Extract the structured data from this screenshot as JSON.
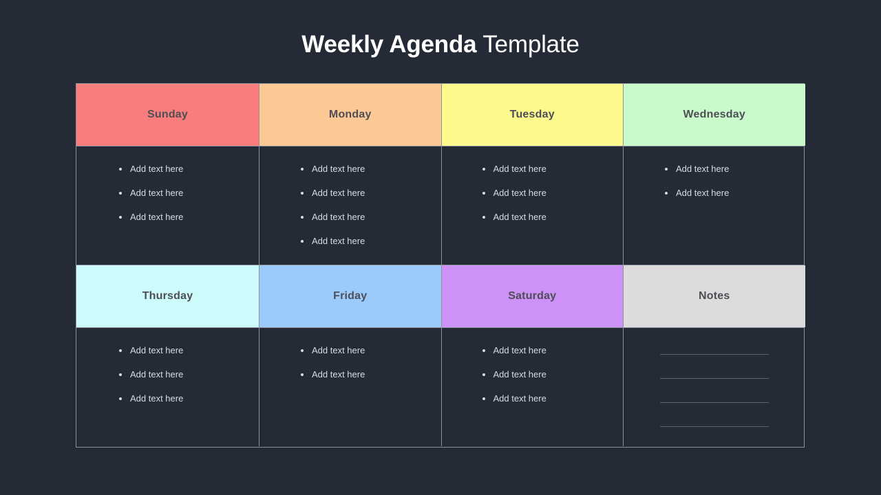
{
  "title": {
    "bold_part": "Weekly Agenda",
    "light_part": " Template"
  },
  "colors": {
    "background": "#242a36",
    "grid_border": "#8d929c",
    "header_text": "#4e4e56",
    "body_text": "#d8dce3",
    "notes_rule": "#5d6573",
    "sunday": "#fa7d7d",
    "monday": "#fcc893",
    "tuesday": "#fcf98d",
    "wednesday": "#c8facc",
    "thursday": "#cdfbfb",
    "friday": "#9bcafb",
    "saturday": "#ce91f7",
    "notes": "#dcdcdc"
  },
  "row1": {
    "headers": [
      {
        "label": "Sunday",
        "color": "#fa7d7d"
      },
      {
        "label": "Monday",
        "color": "#fcc893"
      },
      {
        "label": "Tuesday",
        "color": "#fcf98d"
      },
      {
        "label": "Wednesday",
        "color": "#c8facc"
      }
    ],
    "columns": [
      {
        "day": "Sunday",
        "items": [
          "Add text here",
          "Add text here",
          "Add text here"
        ]
      },
      {
        "day": "Monday",
        "items": [
          "Add text here",
          "Add text here",
          "Add text here",
          "Add text here"
        ]
      },
      {
        "day": "Tuesday",
        "items": [
          "Add text here",
          "Add text here",
          "Add text here"
        ]
      },
      {
        "day": "Wednesday",
        "items": [
          "Add text here",
          "Add text here"
        ]
      }
    ]
  },
  "row2": {
    "headers": [
      {
        "label": "Thursday",
        "color": "#cdfbfb"
      },
      {
        "label": "Friday",
        "color": "#9bcafb"
      },
      {
        "label": "Saturday",
        "color": "#ce91f7"
      },
      {
        "label": "Notes",
        "color": "#dcdcdc"
      }
    ],
    "columns": [
      {
        "day": "Thursday",
        "items": [
          "Add text here",
          "Add text here",
          "Add text here"
        ]
      },
      {
        "day": "Friday",
        "items": [
          "Add text here",
          "Add text here"
        ]
      },
      {
        "day": "Saturday",
        "items": [
          "Add text here",
          "Add text here",
          "Add text here"
        ]
      },
      {
        "day": "Notes",
        "items": [],
        "ruled_lines": 4
      }
    ]
  }
}
